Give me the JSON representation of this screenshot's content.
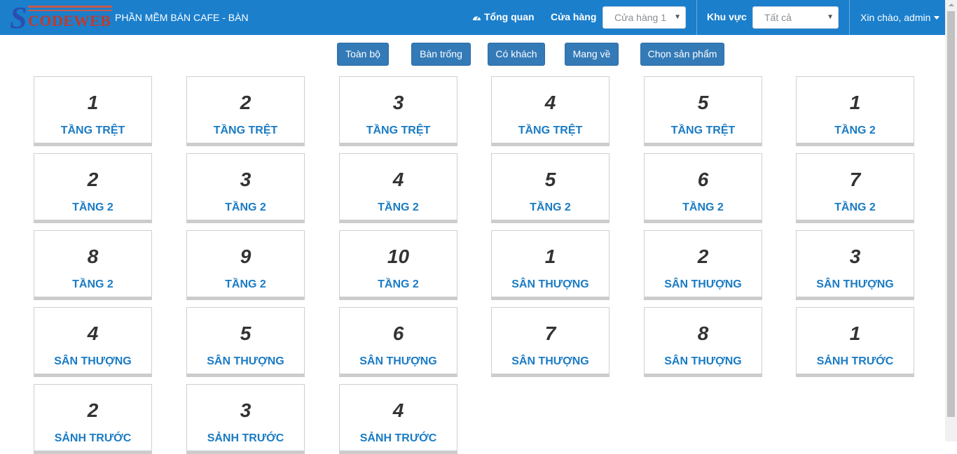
{
  "navbar": {
    "logo_letter": "S",
    "logo_word": "CODEWEB",
    "title": "PHẦN MỀM BÁN CAFE - BÀN",
    "overview_label": "Tổng quan",
    "store_label": "Cửa hàng",
    "store_value": "Cửa hàng 1",
    "area_label": "Khu vực",
    "area_value": "Tất cả",
    "greeting": "Xin chào, admin",
    "icons": [
      "dashboard-icon",
      "caret-down-icon"
    ]
  },
  "filters": [
    {
      "label": "Toàn bộ"
    },
    {
      "label": "Bàn trống"
    },
    {
      "label": "Có khách"
    },
    {
      "label": "Mang về"
    },
    {
      "label": "Chọn sản phẩm"
    }
  ],
  "tables": [
    {
      "number": "1",
      "area": "TẦNG TRỆT"
    },
    {
      "number": "2",
      "area": "TẦNG TRỆT"
    },
    {
      "number": "3",
      "area": "TẦNG TRỆT"
    },
    {
      "number": "4",
      "area": "TẦNG TRỆT"
    },
    {
      "number": "5",
      "area": "TẦNG TRỆT"
    },
    {
      "number": "1",
      "area": "TẦNG 2"
    },
    {
      "number": "2",
      "area": "TẦNG 2"
    },
    {
      "number": "3",
      "area": "TẦNG 2"
    },
    {
      "number": "4",
      "area": "TẦNG 2"
    },
    {
      "number": "5",
      "area": "TẦNG 2"
    },
    {
      "number": "6",
      "area": "TẦNG 2"
    },
    {
      "number": "7",
      "area": "TẦNG 2"
    },
    {
      "number": "8",
      "area": "TẦNG 2"
    },
    {
      "number": "9",
      "area": "TẦNG 2"
    },
    {
      "number": "10",
      "area": "TẦNG 2"
    },
    {
      "number": "1",
      "area": "SÂN THƯỢNG"
    },
    {
      "number": "2",
      "area": "SÂN THƯỢNG"
    },
    {
      "number": "3",
      "area": "SÂN THƯỢNG"
    },
    {
      "number": "4",
      "area": "SÂN THƯỢNG"
    },
    {
      "number": "5",
      "area": "SÂN THƯỢNG"
    },
    {
      "number": "6",
      "area": "SÂN THƯỢNG"
    },
    {
      "number": "7",
      "area": "SÂN THƯỢNG"
    },
    {
      "number": "8",
      "area": "SÂN THƯỢNG"
    },
    {
      "number": "1",
      "area": "SẢNH TRƯỚC"
    },
    {
      "number": "2",
      "area": "SẢNH TRƯỚC"
    },
    {
      "number": "3",
      "area": "SẢNH TRƯỚC"
    },
    {
      "number": "4",
      "area": "SẢNH TRƯỚC"
    }
  ],
  "colors": {
    "navbar": "#1b7fcc",
    "button": "#337ab7",
    "area_text": "#1a7bc4",
    "number_text": "#333333"
  }
}
